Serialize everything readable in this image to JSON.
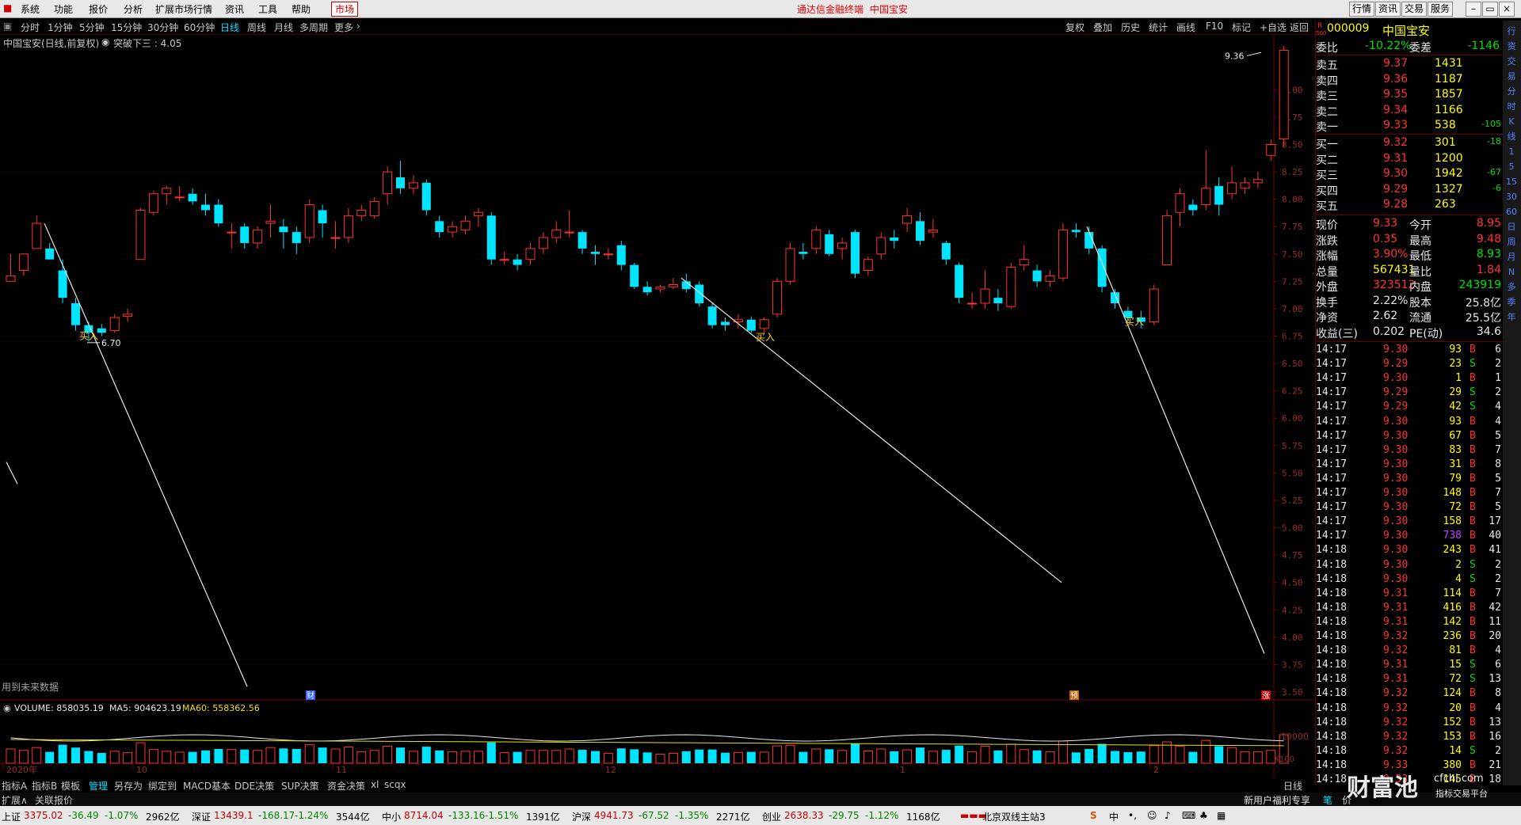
{
  "menu": {
    "items": [
      "系统",
      "功能",
      "报价",
      "分析",
      "扩展市场行情",
      "资讯",
      "工具",
      "帮助"
    ],
    "market": "市场",
    "center_title": "通达信金融终端",
    "center_stock": "中国宝安",
    "right_buttons": [
      "行情",
      "资讯",
      "交易",
      "服务"
    ]
  },
  "period_bar": {
    "items": [
      "分时",
      "1分钟",
      "5分钟",
      "15分钟",
      "30分钟",
      "60分钟",
      "日线",
      "周线",
      "月线",
      "多周期",
      "更多"
    ],
    "active": "日线",
    "tools": [
      "复权",
      "叠加",
      "历史",
      "统计",
      "画线",
      "F10",
      "标记",
      "+自选",
      "返回"
    ]
  },
  "chart": {
    "title": "中国宝安(日线,前复权)",
    "indicator": "突破下三 : 4.05",
    "max_label": "9.36",
    "min_label": "6.70",
    "buy_label": "买入",
    "future_data_note": "用到未来数据",
    "markers": [
      "财",
      "预",
      "涨"
    ],
    "y_ticks": [
      "9.00",
      "8.75",
      "8.50",
      "8.25",
      "8.00",
      "7.75",
      "7.50",
      "7.25",
      "7.00",
      "6.75",
      "6.50",
      "6.25",
      "6.00",
      "5.75",
      "5.50",
      "5.25",
      "5.00",
      "4.75",
      "4.50",
      "4.25",
      "4.00",
      "3.75",
      "3.50"
    ],
    "x_labels": [
      "2020年",
      "10",
      "11",
      "12",
      "1",
      "2"
    ],
    "volume_label": "VOLUME: 858035.19",
    "ma5_label": "MA5: 904623.19",
    "ma60_label": "MA60: 558362.56",
    "vol_axis": "10000",
    "vol_unit": "X100",
    "period_label": "日线"
  },
  "chart_data": {
    "type": "candlestick",
    "series_label": "中国宝安 日线",
    "ylim": [
      3.5,
      9.4
    ],
    "candles": [
      [
        7.25,
        7.3,
        7.5,
        7.25
      ],
      [
        7.35,
        7.5,
        7.5,
        7.3
      ],
      [
        7.55,
        7.78,
        7.85,
        7.55
      ],
      [
        7.55,
        7.45,
        7.6,
        7.45
      ],
      [
        7.35,
        7.1,
        7.45,
        7.05
      ],
      [
        7.05,
        6.85,
        7.1,
        6.8
      ],
      [
        6.85,
        6.78,
        6.88,
        6.7
      ],
      [
        6.82,
        6.78,
        6.86,
        6.75
      ],
      [
        6.8,
        6.92,
        6.95,
        6.78
      ],
      [
        6.93,
        6.95,
        7.0,
        6.88
      ],
      [
        7.45,
        7.9,
        7.92,
        7.45
      ],
      [
        7.88,
        8.05,
        8.08,
        7.85
      ],
      [
        8.05,
        8.1,
        8.12,
        7.95
      ],
      [
        8.02,
        8.02,
        8.12,
        7.98
      ],
      [
        8.05,
        7.98,
        8.1,
        7.95
      ],
      [
        7.95,
        7.9,
        8.05,
        7.85
      ],
      [
        7.95,
        7.78,
        8.0,
        7.75
      ],
      [
        7.7,
        7.7,
        7.78,
        7.55
      ],
      [
        7.75,
        7.6,
        7.78,
        7.55
      ],
      [
        7.6,
        7.72,
        7.75,
        7.55
      ],
      [
        7.78,
        7.8,
        7.95,
        7.65
      ],
      [
        7.75,
        7.7,
        7.82,
        7.55
      ],
      [
        7.7,
        7.6,
        7.75,
        7.5
      ],
      [
        7.65,
        7.95,
        8.0,
        7.6
      ],
      [
        7.9,
        7.78,
        7.95,
        7.65
      ],
      [
        7.65,
        7.65,
        7.8,
        7.55
      ],
      [
        7.65,
        7.85,
        7.92,
        7.6
      ],
      [
        7.85,
        7.9,
        7.95,
        7.8
      ],
      [
        7.85,
        7.98,
        8.02,
        7.82
      ],
      [
        8.05,
        8.25,
        8.3,
        7.95
      ],
      [
        8.2,
        8.1,
        8.35,
        8.05
      ],
      [
        8.1,
        8.15,
        8.22,
        8.05
      ],
      [
        8.15,
        7.9,
        8.18,
        7.85
      ],
      [
        7.8,
        7.7,
        7.85,
        7.65
      ],
      [
        7.7,
        7.75,
        7.8,
        7.65
      ],
      [
        7.72,
        7.8,
        7.85,
        7.68
      ],
      [
        7.85,
        7.88,
        7.92,
        7.75
      ],
      [
        7.85,
        7.45,
        7.88,
        7.4
      ],
      [
        7.45,
        7.45,
        7.52,
        7.4
      ],
      [
        7.45,
        7.4,
        7.5,
        7.35
      ],
      [
        7.45,
        7.55,
        7.6,
        7.4
      ],
      [
        7.55,
        7.65,
        7.7,
        7.5
      ],
      [
        7.65,
        7.72,
        7.8,
        7.6
      ],
      [
        7.7,
        7.7,
        7.9,
        7.65
      ],
      [
        7.7,
        7.55,
        7.72,
        7.5
      ],
      [
        7.52,
        7.5,
        7.58,
        7.4
      ],
      [
        7.5,
        7.5,
        7.55,
        7.45
      ],
      [
        7.58,
        7.4,
        7.62,
        7.35
      ],
      [
        7.4,
        7.2,
        7.42,
        7.18
      ],
      [
        7.2,
        7.15,
        7.25,
        7.12
      ],
      [
        7.18,
        7.2,
        7.22,
        7.15
      ],
      [
        7.2,
        7.22,
        7.28,
        7.18
      ],
      [
        7.25,
        7.18,
        7.32,
        7.15
      ],
      [
        7.22,
        7.05,
        7.25,
        7.02
      ],
      [
        7.02,
        6.85,
        7.05,
        6.82
      ],
      [
        6.88,
        6.85,
        6.92,
        6.8
      ],
      [
        6.88,
        6.9,
        6.95,
        6.82
      ],
      [
        6.9,
        6.8,
        6.93,
        6.78
      ],
      [
        6.82,
        6.9,
        6.92,
        6.78
      ],
      [
        6.95,
        7.25,
        7.28,
        6.92
      ],
      [
        7.25,
        7.55,
        7.6,
        7.22
      ],
      [
        7.52,
        7.5,
        7.6,
        7.45
      ],
      [
        7.55,
        7.72,
        7.75,
        7.5
      ],
      [
        7.68,
        7.5,
        7.72,
        7.48
      ],
      [
        7.55,
        7.6,
        7.65,
        7.45
      ],
      [
        7.7,
        7.32,
        7.72,
        7.28
      ],
      [
        7.35,
        7.45,
        7.48,
        7.3
      ],
      [
        7.5,
        7.65,
        7.7,
        7.45
      ],
      [
        7.65,
        7.62,
        7.72,
        7.55
      ],
      [
        7.78,
        7.85,
        7.92,
        7.7
      ],
      [
        7.8,
        7.62,
        7.88,
        7.58
      ],
      [
        7.7,
        7.72,
        7.82,
        7.65
      ],
      [
        7.6,
        7.45,
        7.62,
        7.4
      ],
      [
        7.4,
        7.1,
        7.42,
        7.05
      ],
      [
        7.05,
        7.05,
        7.15,
        7.0
      ],
      [
        7.05,
        7.18,
        7.35,
        7.0
      ],
      [
        7.1,
        7.05,
        7.18,
        6.98
      ],
      [
        7.02,
        7.38,
        7.42,
        7.0
      ],
      [
        7.4,
        7.45,
        7.58,
        7.35
      ],
      [
        7.35,
        7.25,
        7.4,
        7.2
      ],
      [
        7.25,
        7.3,
        7.35,
        7.2
      ],
      [
        7.28,
        7.72,
        7.78,
        7.25
      ],
      [
        7.72,
        7.7,
        7.78,
        7.65
      ],
      [
        7.7,
        7.55,
        7.75,
        7.5
      ],
      [
        7.55,
        7.2,
        7.58,
        7.15
      ],
      [
        7.15,
        7.05,
        7.18,
        7.0
      ],
      [
        6.98,
        6.92,
        7.02,
        6.88
      ],
      [
        6.92,
        6.88,
        6.98,
        6.82
      ],
      [
        6.88,
        7.18,
        7.22,
        6.85
      ],
      [
        7.4,
        7.85,
        7.9,
        7.4
      ],
      [
        7.88,
        8.05,
        8.1,
        7.75
      ],
      [
        7.95,
        7.9,
        8.0,
        7.85
      ],
      [
        7.95,
        8.1,
        8.45,
        7.9
      ],
      [
        8.12,
        7.95,
        8.2,
        7.85
      ],
      [
        8.05,
        8.15,
        8.3,
        8.0
      ],
      [
        8.1,
        8.15,
        8.2,
        8.05
      ],
      [
        8.15,
        8.18,
        8.25,
        8.1
      ],
      [
        8.4,
        8.5,
        8.55,
        8.35
      ],
      [
        8.55,
        9.36,
        9.4,
        8.48
      ]
    ],
    "volume": {
      "ma5_label": "MA5",
      "ma60_label": "MA60"
    }
  },
  "quote": {
    "code": "000009",
    "name": "中国宝安",
    "r_label": "R",
    "r_sub": "500",
    "weibi_label": "委比",
    "weibi": "-10.22%",
    "weicha_label": "委差",
    "weicha": "-1146",
    "asks": [
      {
        "label": "卖五",
        "price": "9.37",
        "vol": "1431",
        "chg": ""
      },
      {
        "label": "卖四",
        "price": "9.36",
        "vol": "1187",
        "chg": ""
      },
      {
        "label": "卖三",
        "price": "9.35",
        "vol": "1857",
        "chg": ""
      },
      {
        "label": "卖二",
        "price": "9.34",
        "vol": "1166",
        "chg": ""
      },
      {
        "label": "卖一",
        "price": "9.33",
        "vol": "538",
        "chg": "-105"
      }
    ],
    "bids": [
      {
        "label": "买一",
        "price": "9.32",
        "vol": "301",
        "chg": "-18"
      },
      {
        "label": "买二",
        "price": "9.31",
        "vol": "1200",
        "chg": ""
      },
      {
        "label": "买三",
        "price": "9.30",
        "vol": "1942",
        "chg": "-67"
      },
      {
        "label": "买四",
        "price": "9.29",
        "vol": "1327",
        "chg": "-6"
      },
      {
        "label": "买五",
        "price": "9.28",
        "vol": "263",
        "chg": ""
      }
    ],
    "stats": [
      {
        "l1": "现价",
        "v1": "9.33",
        "l2": "今开",
        "v2": "8.95",
        "c1": "red",
        "c2": "red"
      },
      {
        "l1": "涨跌",
        "v1": "0.35",
        "l2": "最高",
        "v2": "9.48",
        "c1": "red",
        "c2": "red"
      },
      {
        "l1": "涨幅",
        "v1": "3.90%",
        "l2": "最低",
        "v2": "8.93",
        "c1": "red",
        "c2": "green"
      },
      {
        "l1": "总量",
        "v1": "567431",
        "l2": "量比",
        "v2": "1.84",
        "c1": "yellow",
        "c2": "red"
      },
      {
        "l1": "外盘",
        "v1": "323512",
        "l2": "内盘",
        "v2": "243919",
        "c1": "red",
        "c2": "green"
      },
      {
        "l1": "换手",
        "v1": "2.22%",
        "l2": "股本",
        "v2": "25.8亿",
        "c1": "white",
        "c2": "white"
      },
      {
        "l1": "净资",
        "v1": "2.62",
        "l2": "流通",
        "v2": "25.5亿",
        "c1": "white",
        "c2": "white"
      },
      {
        "l1": "收益(三)",
        "v1": "0.202",
        "l2": "PE(动)",
        "v2": "34.6",
        "c1": "white",
        "c2": "white"
      }
    ],
    "ticks": [
      [
        "14:17",
        "9.30",
        "93",
        "B",
        "6"
      ],
      [
        "14:17",
        "9.29",
        "23",
        "S",
        "2"
      ],
      [
        "14:17",
        "9.30",
        "1",
        "B",
        "1"
      ],
      [
        "14:17",
        "9.29",
        "29",
        "S",
        "2"
      ],
      [
        "14:17",
        "9.29",
        "42",
        "S",
        "4"
      ],
      [
        "14:17",
        "9.30",
        "93",
        "B",
        "4"
      ],
      [
        "14:17",
        "9.30",
        "67",
        "B",
        "5"
      ],
      [
        "14:17",
        "9.30",
        "83",
        "B",
        "7"
      ],
      [
        "14:17",
        "9.30",
        "31",
        "B",
        "8"
      ],
      [
        "14:17",
        "9.30",
        "79",
        "B",
        "5"
      ],
      [
        "14:17",
        "9.30",
        "148",
        "B",
        "7"
      ],
      [
        "14:17",
        "9.30",
        "72",
        "B",
        "5"
      ],
      [
        "14:17",
        "9.30",
        "158",
        "B",
        "17"
      ],
      [
        "14:17",
        "9.30",
        "738",
        "B",
        "40"
      ],
      [
        "14:18",
        "9.30",
        "243",
        "B",
        "41"
      ],
      [
        "14:18",
        "9.30",
        "2",
        "S",
        "2"
      ],
      [
        "14:18",
        "9.30",
        "4",
        "S",
        "2"
      ],
      [
        "14:18",
        "9.31",
        "114",
        "B",
        "7"
      ],
      [
        "14:18",
        "9.31",
        "416",
        "B",
        "42"
      ],
      [
        "14:18",
        "9.31",
        "142",
        "B",
        "11"
      ],
      [
        "14:18",
        "9.32",
        "236",
        "B",
        "20"
      ],
      [
        "14:18",
        "9.32",
        "81",
        "B",
        "4"
      ],
      [
        "14:18",
        "9.31",
        "15",
        "S",
        "6"
      ],
      [
        "14:18",
        "9.31",
        "72",
        "S",
        "13"
      ],
      [
        "14:18",
        "9.32",
        "124",
        "B",
        "8"
      ],
      [
        "14:18",
        "9.32",
        "20",
        "B",
        "4"
      ],
      [
        "14:18",
        "9.32",
        "152",
        "B",
        "13"
      ],
      [
        "14:18",
        "9.32",
        "153",
        "B",
        "16"
      ],
      [
        "14:18",
        "9.32",
        "14",
        "S",
        "2"
      ],
      [
        "14:18",
        "9.33",
        "380",
        "B",
        "21"
      ],
      [
        "14:18",
        "9.33",
        "145",
        "B",
        "18"
      ]
    ]
  },
  "right_tools": [
    "行",
    "资",
    "交",
    "易",
    "分",
    "时",
    "K",
    "线",
    "1",
    "5",
    "15",
    "30",
    "60",
    "日",
    "周",
    "月",
    "N",
    "多",
    "季",
    "年"
  ],
  "indicator_bar": [
    "指标A",
    "指标B",
    "模板",
    "管理",
    "另存为",
    "绑定到",
    "MACD基本",
    "DDE决策",
    "SUP决策",
    "资金决策",
    "xl",
    "scqx"
  ],
  "indicator_active": "管理",
  "ext_bar": {
    "left": "扩展∧",
    "quote": "关联报价",
    "promo": "新用户福利专享",
    "pen": "笔",
    "value": "价"
  },
  "status": [
    {
      "name": "上证",
      "val": "3375.02",
      "chg": "-36.49",
      "pct": "-1.07%",
      "amt": "2962亿"
    },
    {
      "name": "深证",
      "val": "13439.1",
      "chg": "-168.17",
      "pct": "-1.24%",
      "amt": "3544亿"
    },
    {
      "name": "中小",
      "val": "8714.04",
      "chg": "-133.16",
      "pct": "-1.51%",
      "amt": "1391亿"
    },
    {
      "name": "沪深",
      "val": "4941.73",
      "chg": "-67.52",
      "pct": "-1.35%",
      "amt": "2271亿"
    },
    {
      "name": "创业",
      "val": "2638.33",
      "chg": "-29.75",
      "pct": "-1.12%",
      "amt": "1168亿"
    }
  ],
  "server": "北京双线主站3",
  "watermark": "财富池",
  "watermark_url": "cfchi.com",
  "watermark_sub": "指标交易平台",
  "colors": {
    "up": "#ff3232",
    "down": "#00e5ff",
    "grid": "#600000",
    "ma5": "#e8e8e8",
    "ma60": "#e8e000"
  }
}
